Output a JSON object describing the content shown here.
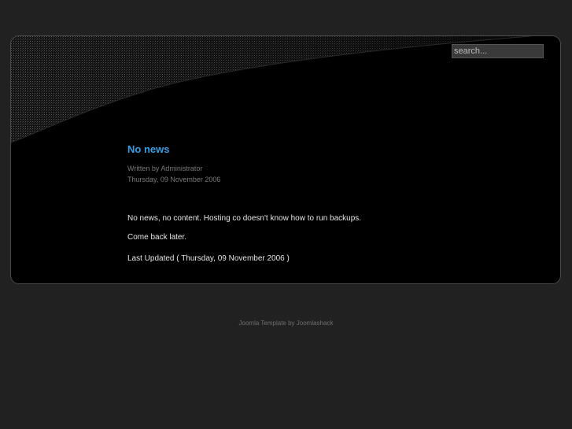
{
  "search": {
    "placeholder": "search..."
  },
  "article": {
    "title": "No news",
    "author": "Written by Administrator",
    "date": "Thursday, 09 November 2006",
    "body": [
      "No news, no content.  Hosting co doesn't know how to run backups.",
      "Come back later."
    ],
    "last_updated": "Last Updated ( Thursday, 09 November 2006 )"
  },
  "footer": {
    "credit": "Joomla Template by Joomlashack"
  },
  "colors": {
    "background": "#212121",
    "panel": "#000000",
    "title_link": "#3a9ee4"
  }
}
